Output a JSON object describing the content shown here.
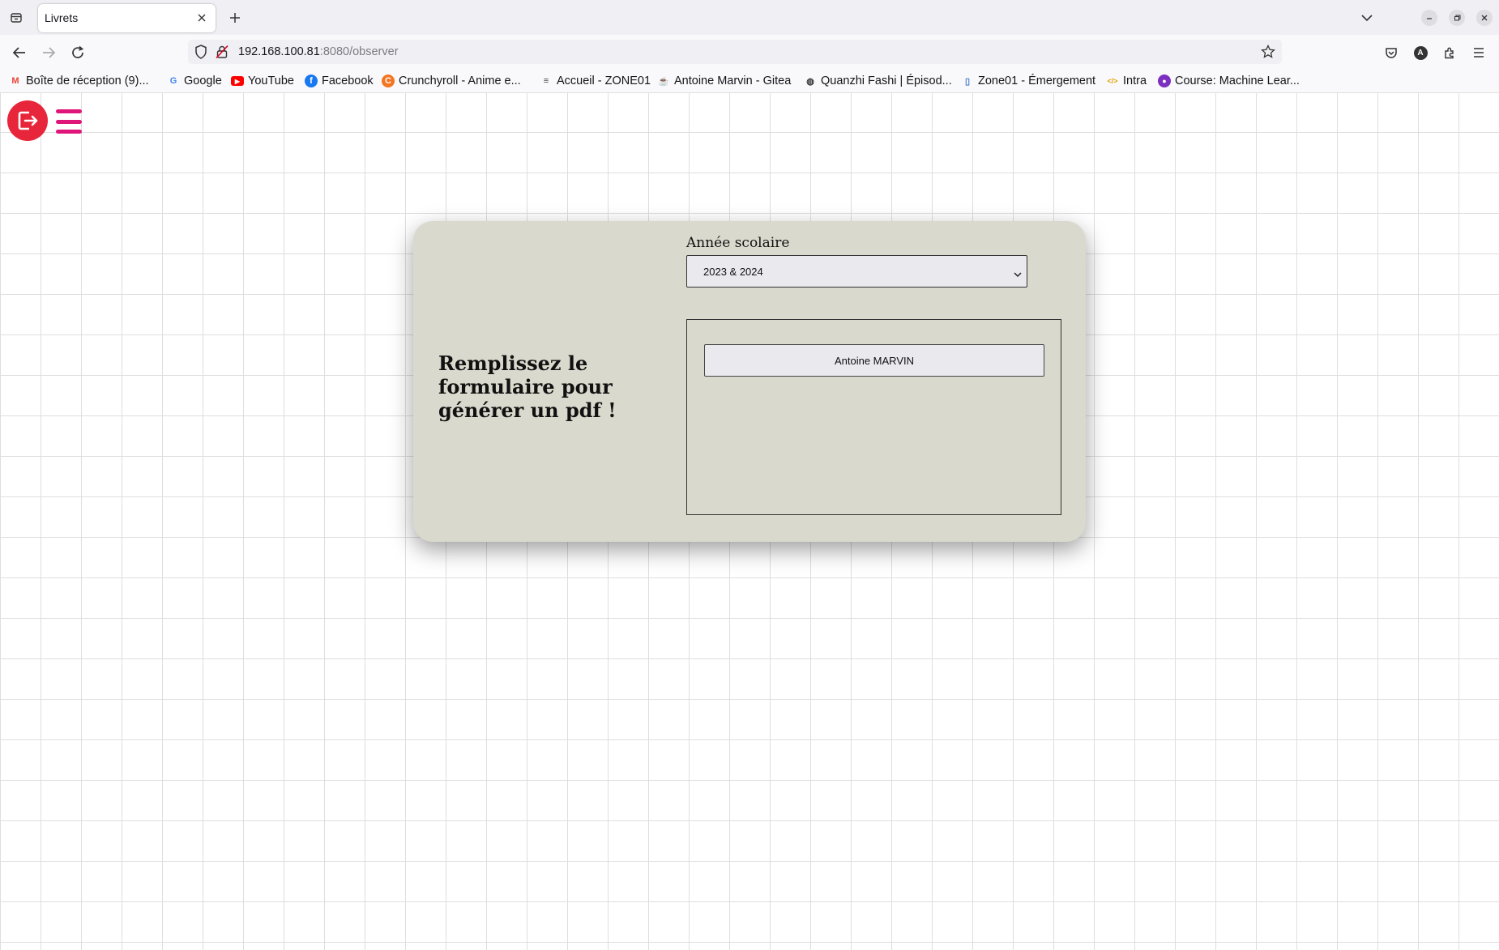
{
  "browser": {
    "tab_title": "Livrets",
    "url_host": "192.168.100.81",
    "url_path": ":8080/observer",
    "profile_initial": "A",
    "bookmarks": [
      {
        "label": "Boîte de réception (9)...",
        "icon": "gmail-icon",
        "color": "#ea4335",
        "glyph": "M"
      },
      {
        "label": "Google",
        "icon": "google-icon",
        "color": "#4285f4",
        "glyph": "G"
      },
      {
        "label": "YouTube",
        "icon": "youtube-icon",
        "color": "#ff0000",
        "glyph": "▶"
      },
      {
        "label": "Facebook",
        "icon": "facebook-icon",
        "color": "#1877f2",
        "glyph": "f"
      },
      {
        "label": "Crunchyroll - Anime e...",
        "icon": "crunchyroll-icon",
        "color": "#f47521",
        "glyph": "C"
      },
      {
        "label": "Accueil - ZONE01",
        "icon": "zone01-icon",
        "color": "#444444",
        "glyph": "≡"
      },
      {
        "label": "Antoine Marvin - Gitea",
        "icon": "gitea-icon",
        "color": "#609926",
        "glyph": "☕"
      },
      {
        "label": "Quanzhi Fashi | Épisod...",
        "icon": "globe-icon",
        "color": "#333333",
        "glyph": "◍"
      },
      {
        "label": "Zone01 - Émergement",
        "icon": "zone01-doc-icon",
        "color": "#4a7bd0",
        "glyph": "▯"
      },
      {
        "label": "Intra",
        "icon": "code-icon",
        "color": "#e0a000",
        "glyph": "</>"
      },
      {
        "label": "Course: Machine Lear...",
        "icon": "course-icon",
        "color": "#7b2fbf",
        "glyph": "●"
      }
    ]
  },
  "page": {
    "heading": "Remplissez le formulaire pour générer un pdf !",
    "year_label": "Année scolaire",
    "year_selected": "2023 & 2024",
    "students": [
      "Antoine MARVIN"
    ]
  },
  "colors": {
    "logout_button": "#e8263b",
    "menu_icon": "#e0157a",
    "card_background": "#d9d9cd"
  }
}
